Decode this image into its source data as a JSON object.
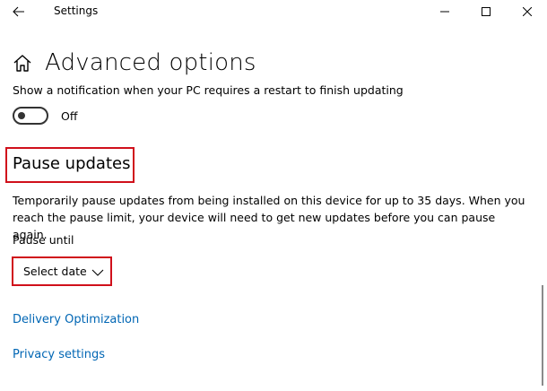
{
  "titlebar": {
    "app_title": "Settings",
    "back_icon": "back-arrow-icon",
    "minimize_icon": "minimize-icon",
    "maximize_icon": "maximize-icon",
    "close_icon": "close-icon"
  },
  "header": {
    "home_icon": "home-icon",
    "title": "Advanced options"
  },
  "restart_notification": {
    "label": "Show a notification when your PC requires a restart to finish updating",
    "toggle_state": "Off"
  },
  "pause_updates": {
    "heading": "Pause updates",
    "description": "Temporarily pause updates from being installed on this device for up to 35 days. When you reach the pause limit, your device will need to get new updates before you can pause again.",
    "pause_until_label": "Pause until",
    "select_value": "Select date"
  },
  "links": {
    "delivery_optimization": "Delivery Optimization",
    "privacy_settings": "Privacy settings"
  },
  "colors": {
    "link": "#0066b4",
    "highlight_box": "#d0101b"
  }
}
